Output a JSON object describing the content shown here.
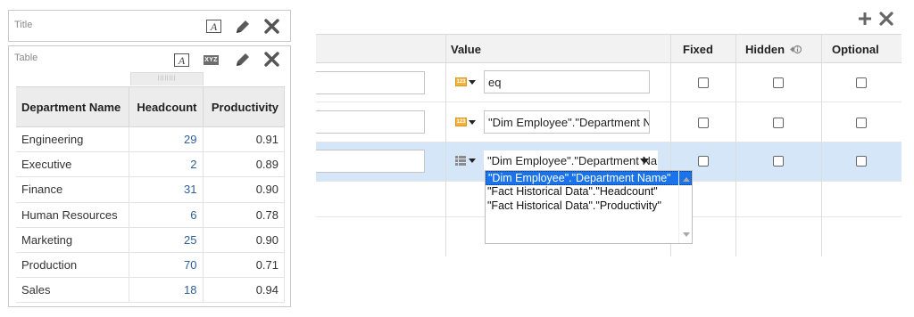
{
  "title_view": {
    "label": "Title",
    "tools": [
      "format-text-icon",
      "pencil-icon",
      "close-icon"
    ]
  },
  "table_view": {
    "label": "Table",
    "tools": [
      "format-text-icon",
      "xyz-icon",
      "pencil-icon",
      "close-icon"
    ],
    "xyz_label": "XYZ",
    "format_label": "A",
    "columns": [
      "Department Name",
      "Headcount",
      "Productivity"
    ],
    "rows": [
      [
        "Engineering",
        "29",
        "0.91"
      ],
      [
        "Executive",
        "2",
        "0.89"
      ],
      [
        "Finance",
        "31",
        "0.90"
      ],
      [
        "Human Resources",
        "6",
        "0.78"
      ],
      [
        "Marketing",
        "25",
        "0.90"
      ],
      [
        "Production",
        "70",
        "0.71"
      ],
      [
        "Sales",
        "18",
        "0.94"
      ]
    ]
  },
  "prompts": {
    "columns": {
      "value": "Value",
      "fixed": "Fixed",
      "hidden": "Hidden",
      "optional": "Optional"
    },
    "rows": [
      {
        "value_type": "123",
        "value": "eq",
        "fixed": false,
        "hidden": false,
        "optional": false
      },
      {
        "value_type": "123",
        "value": "\"Dim Employee\".\"Department Nа",
        "fixed": false,
        "hidden": false,
        "optional": false
      },
      {
        "value_type": "list",
        "value": "\"Dim Employee\".\"Department Nа",
        "fixed": false,
        "hidden": false,
        "optional": false,
        "selected": true
      }
    ],
    "dropdown_options": [
      "\"Dim Employee\".\"Department Name\"",
      "\"Fact Historical Data\".\"Headcount\"",
      "\"Fact Historical Data\".\"Productivity\""
    ],
    "dropdown_selected_index": 0
  },
  "icons": {
    "add": "plus-icon",
    "remove": "close-icon",
    "hidden_info": "info-icon"
  },
  "colors": {
    "selected_row": "#d4e6f7",
    "selected_option": "#1a73e8",
    "headcount_text": "#2f5f96",
    "type_badge": "#f2b13c"
  }
}
